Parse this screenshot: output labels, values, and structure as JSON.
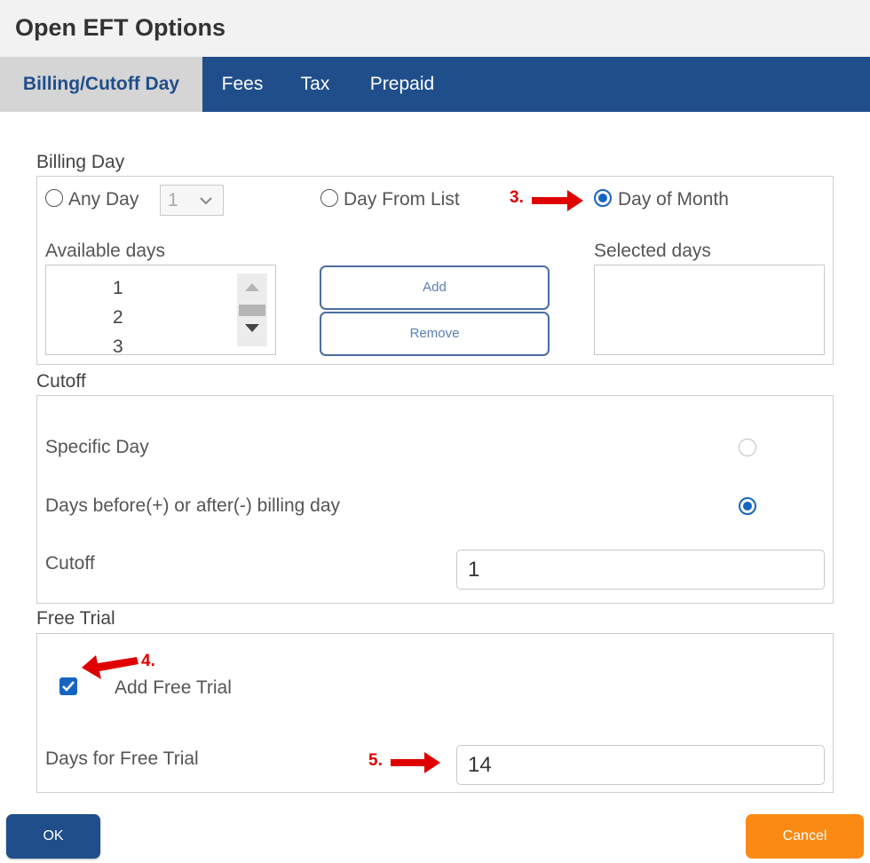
{
  "dialog": {
    "title": "Open EFT Options"
  },
  "tabs": [
    {
      "label": "Billing/Cutoff Day",
      "active": true
    },
    {
      "label": "Fees",
      "active": false
    },
    {
      "label": "Tax",
      "active": false
    },
    {
      "label": "Prepaid",
      "active": false
    }
  ],
  "billing_day": {
    "section_label": "Billing Day",
    "options": {
      "any_day": {
        "label": "Any Day",
        "selected": false
      },
      "day_from_list": {
        "label": "Day From List",
        "selected": false
      },
      "day_of_month": {
        "label": "Day of Month",
        "selected": true
      }
    },
    "any_day_select_value": "1",
    "available_days_label": "Available days",
    "available_days": [
      "1",
      "2",
      "3"
    ],
    "selected_days_label": "Selected days",
    "add_label": "Add",
    "remove_label": "Remove"
  },
  "cutoff": {
    "section_label": "Cutoff",
    "specific_day_label": "Specific Day",
    "specific_day_selected": false,
    "days_before_after_label": "Days before(+) or after(-) billing day",
    "days_before_after_selected": true,
    "cutoff_label": "Cutoff",
    "cutoff_value": "1"
  },
  "free_trial": {
    "section_label": "Free Trial",
    "add_free_trial_label": "Add Free Trial",
    "add_free_trial_checked": true,
    "days_label": "Days for Free Trial",
    "days_value": "14"
  },
  "annotations": {
    "step3": "3.",
    "step4": "4.",
    "step5": "5."
  },
  "footer": {
    "ok_label": "OK",
    "cancel_label": "Cancel"
  },
  "colors": {
    "tab_bar": "#1f4e8a",
    "radio_selected": "#1565c0",
    "cancel": "#fb8a14",
    "annotation": "#e00000"
  }
}
